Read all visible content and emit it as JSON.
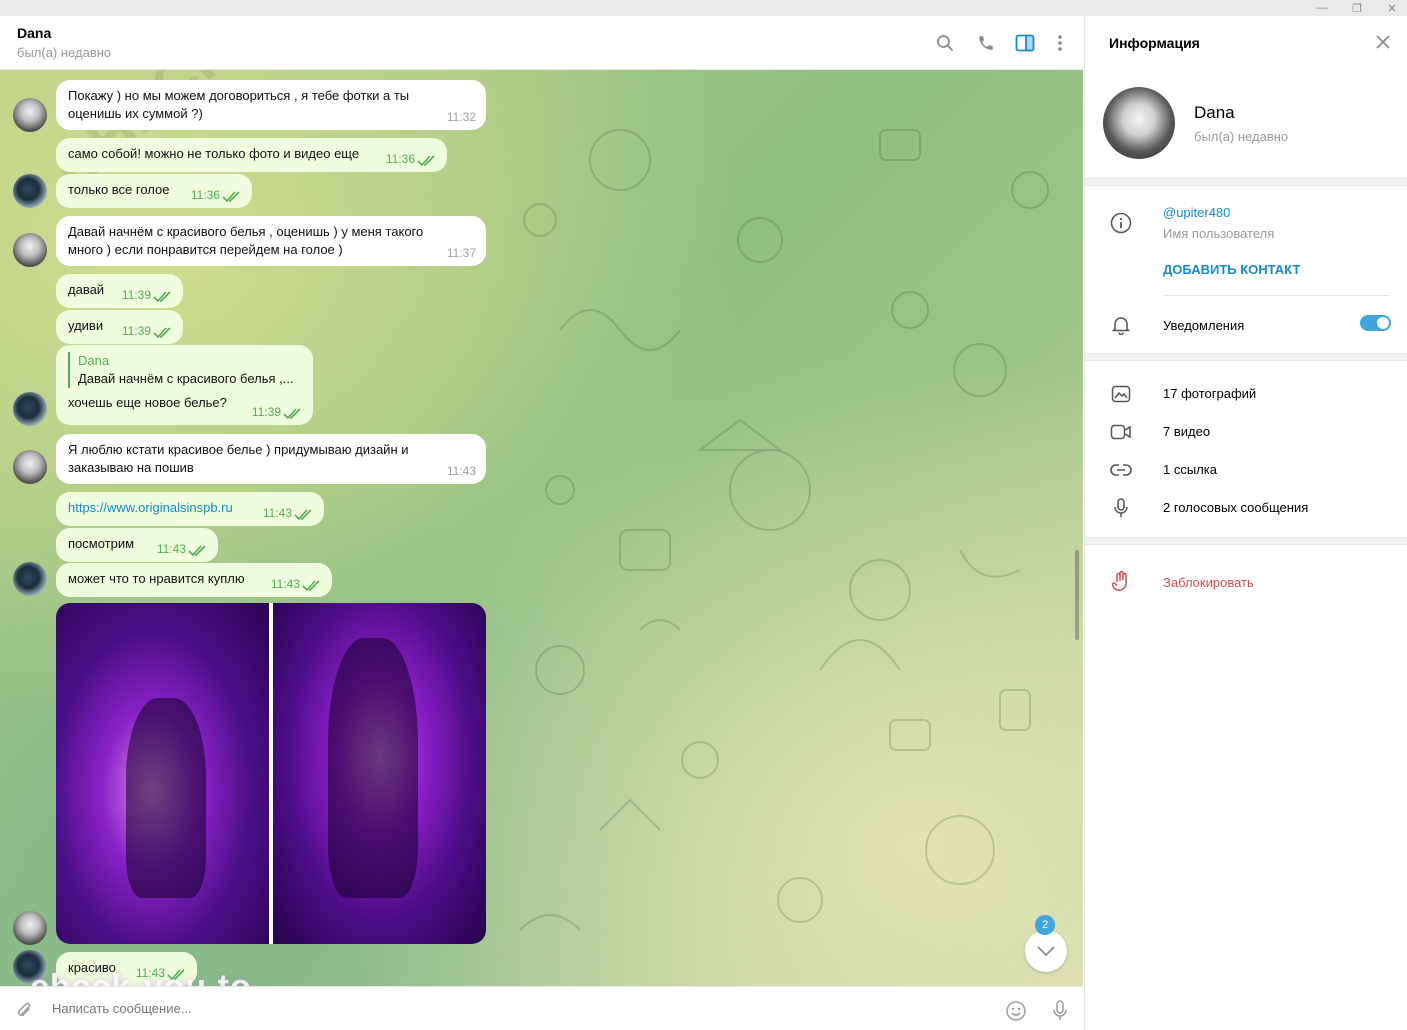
{
  "window": {
    "minimize": "—",
    "maximize": "❐",
    "close": "✕"
  },
  "chat": {
    "title": "Dana",
    "status": "был(а) недавно",
    "composer_placeholder": "Написать сообщение...",
    "unread_count": "2"
  },
  "messages": [
    {
      "side": "in",
      "lines": [
        "Покажу ) но мы можем договориться , я тебе фотки а ты",
        "оценишь их суммой ?)"
      ],
      "time": "11:32"
    },
    {
      "side": "out",
      "lines": [
        "само собой! можно не только фото и видео еще"
      ],
      "time": "11:36"
    },
    {
      "side": "out",
      "lines": [
        "только все голое"
      ],
      "time": "11:36"
    },
    {
      "side": "in",
      "lines": [
        "Давай начнём с красивого белья , оценишь ) у меня такого",
        "много ) если понравится перейдем на голое )"
      ],
      "time": "11:37"
    },
    {
      "side": "out",
      "lines": [
        "давай"
      ],
      "time": "11:39"
    },
    {
      "side": "out",
      "lines": [
        "удиви"
      ],
      "time": "11:39"
    },
    {
      "side": "out",
      "reply_name": "Dana",
      "reply_text": "Давай начнём с красивого белья ,...",
      "lines": [
        "хочешь еще новое белье?"
      ],
      "time": "11:39"
    },
    {
      "side": "in",
      "lines": [
        "Я люблю кстати красивое белье ) придумываю дизайн и",
        "заказываю на пошив"
      ],
      "time": "11:43"
    },
    {
      "side": "out",
      "link": "https://www.originalsinspb.ru",
      "time": "11:43"
    },
    {
      "side": "out",
      "lines": [
        "посмотрим"
      ],
      "time": "11:43"
    },
    {
      "side": "out",
      "lines": [
        "может что то нравится куплю"
      ],
      "time": "11:43"
    },
    {
      "side": "out",
      "lines": [
        "красиво"
      ],
      "time": "11:43"
    }
  ],
  "watermarks": {
    "bottom": "check-you.to",
    "diagonal": "CHECK-YOU.ME"
  },
  "panel": {
    "title": "Информация",
    "name": "Dana",
    "status": "был(а) недавно",
    "username": "@upiter480",
    "username_label": "Имя пользователя",
    "add_contact": "ДОБАВИТЬ КОНТАКТ",
    "notifications": "Уведомления",
    "notifications_on": true,
    "media": [
      {
        "icon": "photo-icon",
        "label": "17 фотографий"
      },
      {
        "icon": "video-icon",
        "label": "7 видео"
      },
      {
        "icon": "link-icon",
        "label": "1 ссылка"
      },
      {
        "icon": "microphone-icon",
        "label": "2 голосовых сообщения"
      }
    ],
    "block": "Заблокировать"
  },
  "colors": {
    "accent": "#168acd",
    "outgoing_bubble": "#effdde",
    "check": "#4fae4e",
    "danger": "#d14e4e",
    "toggle": "#3fa5dd"
  }
}
